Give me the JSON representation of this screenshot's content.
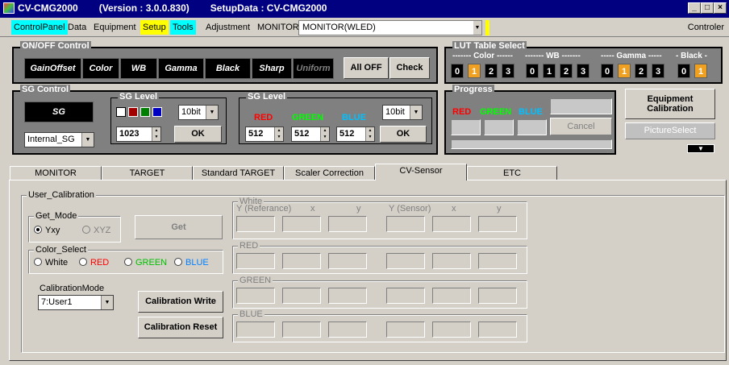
{
  "titlebar": {
    "app": "CV-CMG2000",
    "version": "(Version : 3.0.0.830)",
    "setup": "SetupData : CV-CMG2000",
    "btn_min": "_",
    "btn_max": "□",
    "btn_close": "×"
  },
  "menu": {
    "items": [
      "ControlPanel",
      "Data",
      "Equipment",
      "Setup",
      "Tools",
      "Adjustment",
      "MONITOR"
    ],
    "monitor_value": "MONITOR(WLED)",
    "controler": "Controler"
  },
  "onoff": {
    "title": "ON/OFF Control",
    "buttons": [
      "GainOffset",
      "Color",
      "WB",
      "Gamma",
      "Black",
      "Sharp",
      "Uniform"
    ],
    "alloff": "All OFF",
    "check": "Check"
  },
  "lut": {
    "title": "LUT Table Select",
    "groups": [
      {
        "label": "------- Color ------",
        "values": [
          "0",
          "1",
          "2",
          "3"
        ],
        "selected": 1
      },
      {
        "label": "------- WB -------",
        "values": [
          "0",
          "1",
          "2",
          "3"
        ],
        "selected": -1
      },
      {
        "label": "----- Gamma -----",
        "values": [
          "0",
          "1",
          "2",
          "3"
        ],
        "selected": 1
      },
      {
        "label": "- Black -",
        "values": [
          "0",
          "1"
        ],
        "selected": 1
      }
    ]
  },
  "sg": {
    "title": "SG Control",
    "sg_button": "SG",
    "source": "Internal_SG"
  },
  "sglevel1": {
    "title": "SG Level",
    "bit": "10bit",
    "value": "1023",
    "ok": "OK"
  },
  "sglevel2": {
    "title": "SG Level",
    "red": "RED",
    "green": "GREEN",
    "blue": "BLUE",
    "red_val": "512",
    "green_val": "512",
    "blue_val": "512",
    "bit": "10bit",
    "ok": "OK"
  },
  "progress": {
    "title": "Progress",
    "red": "RED",
    "green": "GREEN",
    "blue": "BLUE",
    "cancel": "Cancel"
  },
  "right": {
    "equip_cal": "Equipment Calibration",
    "picture_select": "PictureSelect"
  },
  "tabs": [
    "MONITOR",
    "TARGET",
    "Standard TARGET",
    "Scaler Correction",
    "CV-Sensor",
    "ETC"
  ],
  "usercal": {
    "title": "User_Calibration",
    "getmode": {
      "title": "Get_Mode",
      "opt1": "Yxy",
      "opt2": "XYZ"
    },
    "get": "Get",
    "colorselect": {
      "title": "Color_Select",
      "white": "White",
      "red": "RED",
      "green": "GREEN",
      "blue": "BLUE"
    },
    "calmode_label": "CalibrationMode",
    "calmode_value": "7:User1",
    "cal_write": "Calibration Write",
    "cal_reset": "Calibration Reset",
    "white": "White",
    "red_grp": "RED",
    "green_grp": "GREEN",
    "blue_grp": "BLUE",
    "col_yref": "Y (Referance)",
    "col_x": "x",
    "col_y": "y",
    "col_ysens": "Y (Sensor)",
    "col_x2": "x",
    "col_y2": "y"
  },
  "colors": {
    "red": "#ff0000",
    "green": "#00c000",
    "blue": "#00c0ff",
    "orange": "#f0a020"
  }
}
